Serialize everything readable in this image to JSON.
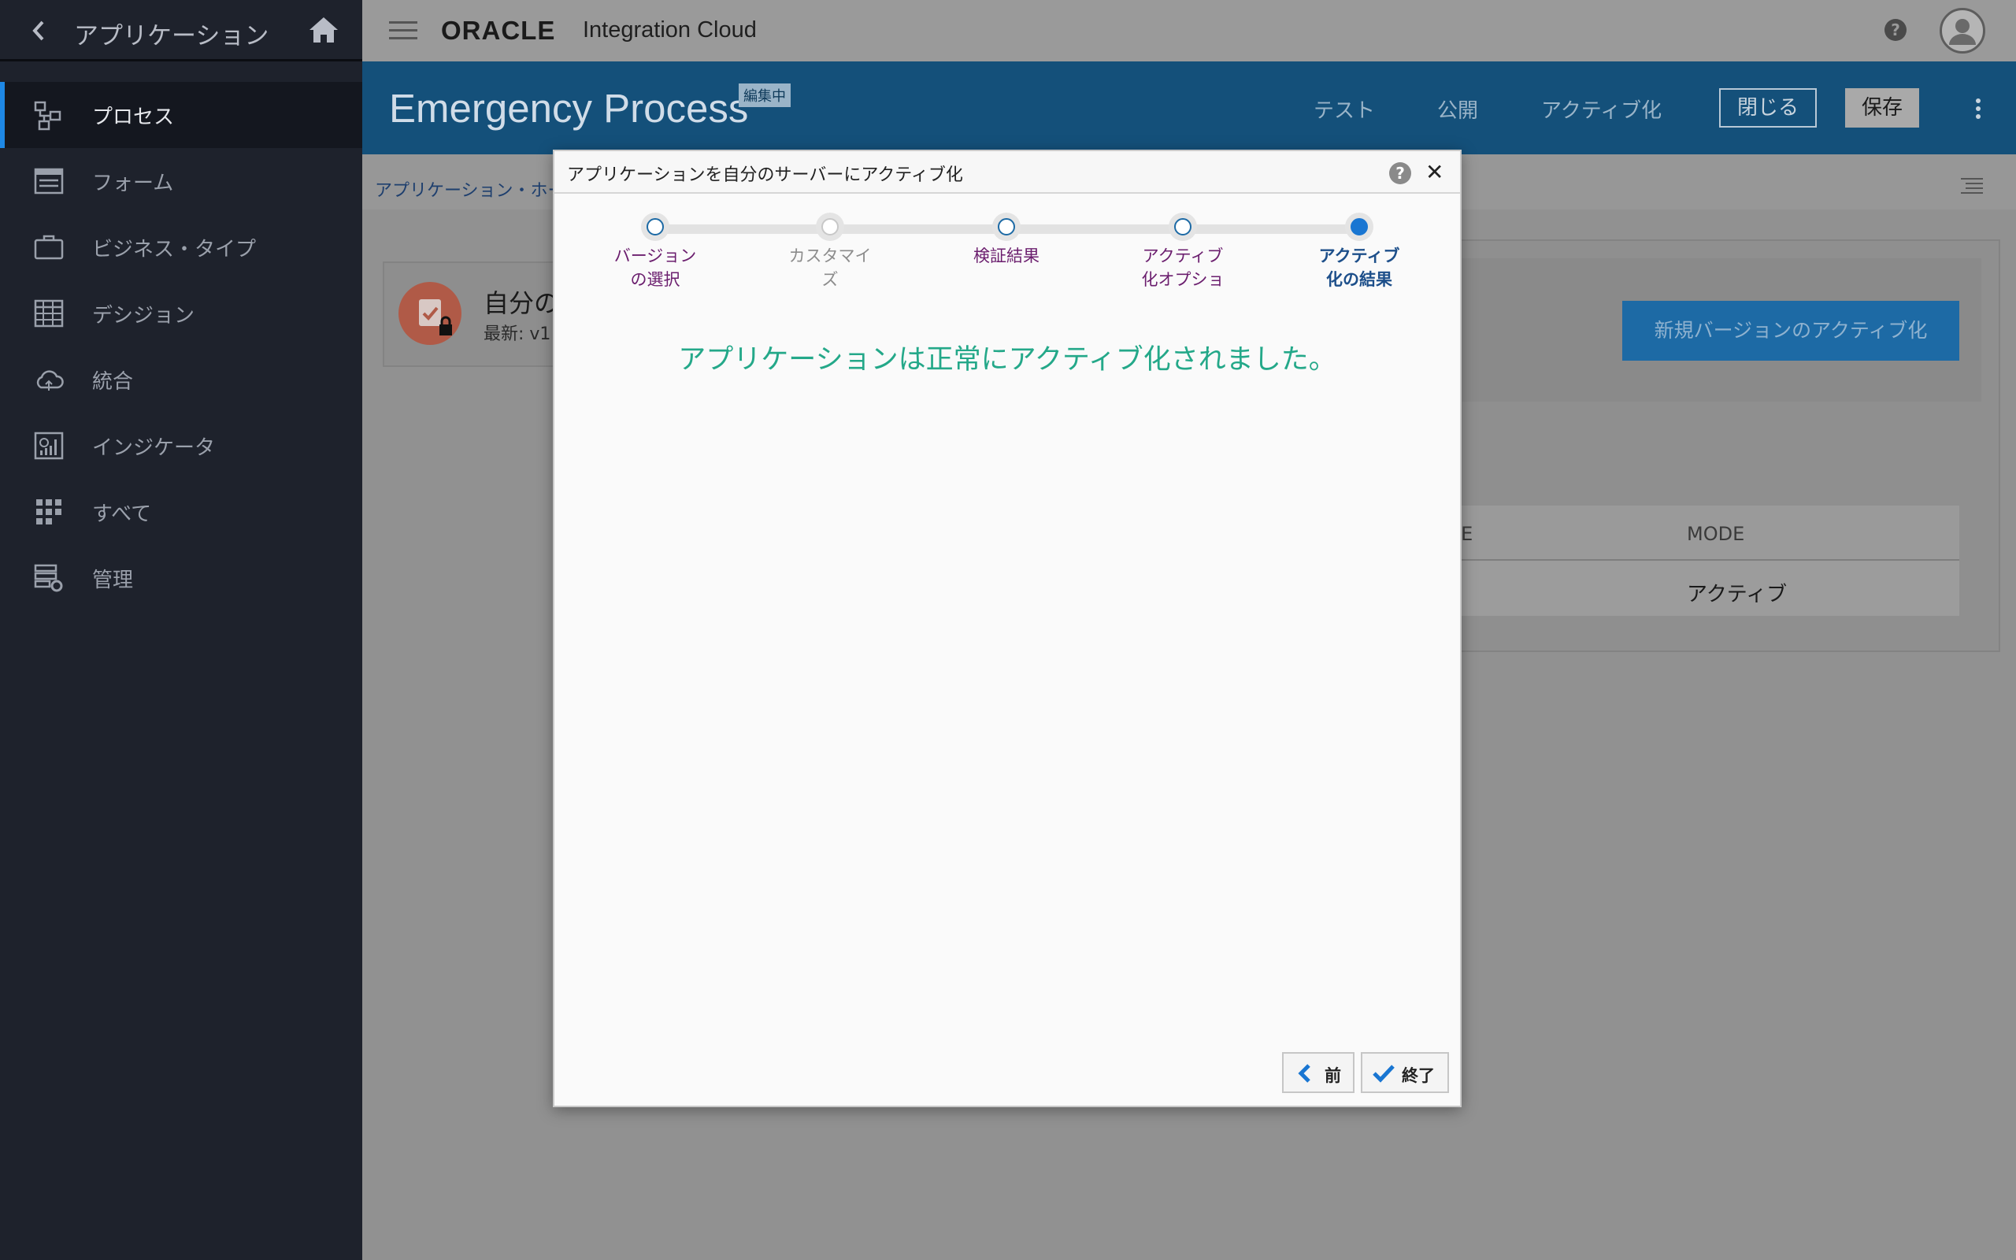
{
  "sidebar": {
    "title": "アプリケーション",
    "items": [
      {
        "label": "プロセス",
        "icon": "process-icon"
      },
      {
        "label": "フォーム",
        "icon": "form-icon"
      },
      {
        "label": "ビジネス・タイプ",
        "icon": "briefcase-icon"
      },
      {
        "label": "デシジョン",
        "icon": "grid-table-icon"
      },
      {
        "label": "統合",
        "icon": "cloud-icon"
      },
      {
        "label": "インジケータ",
        "icon": "indicator-icon"
      },
      {
        "label": "すべて",
        "icon": "apps-grid-icon"
      },
      {
        "label": "管理",
        "icon": "admin-icon"
      }
    ]
  },
  "topbar": {
    "brand": "ORACLE",
    "product": "Integration Cloud",
    "help": "?"
  },
  "header": {
    "title": "Emergency Process",
    "badge": "編集中",
    "links": [
      "テスト",
      "公開",
      "アクティブ化"
    ],
    "close_label": "閉じる",
    "save_label": "保存"
  },
  "content": {
    "breadcrumb": "アプリケーション・ホー",
    "card_title": "自分の",
    "card_subtitle": "最新: v1",
    "activate_new_label": "新規バージョンのアクティブ化",
    "table": {
      "headers": [
        "NAME",
        "MODE"
      ],
      "row": [
        "",
        "アクティブ"
      ]
    }
  },
  "modal": {
    "title": "アプリケーションを自分のサーバーにアクティブ化",
    "help": "?",
    "close": "✕",
    "steps": [
      {
        "label": "バージョン\nの選択",
        "state": "done"
      },
      {
        "label": "カスタマイ\nズ",
        "state": "disabled"
      },
      {
        "label": "検証結果",
        "state": "done"
      },
      {
        "label": "アクティブ\n化オプショ",
        "state": "done"
      },
      {
        "label": "アクティブ\n化の結果",
        "state": "current"
      }
    ],
    "message": "アプリケーションは正常にアクティブ化されました。",
    "prev_label": "前",
    "finish_label": "終了"
  },
  "colors": {
    "accent": "#1976d2",
    "success": "#24a889",
    "step_label": "#6b1e6e",
    "header_blue": "#14507a",
    "sidebar": "#1e222c"
  }
}
